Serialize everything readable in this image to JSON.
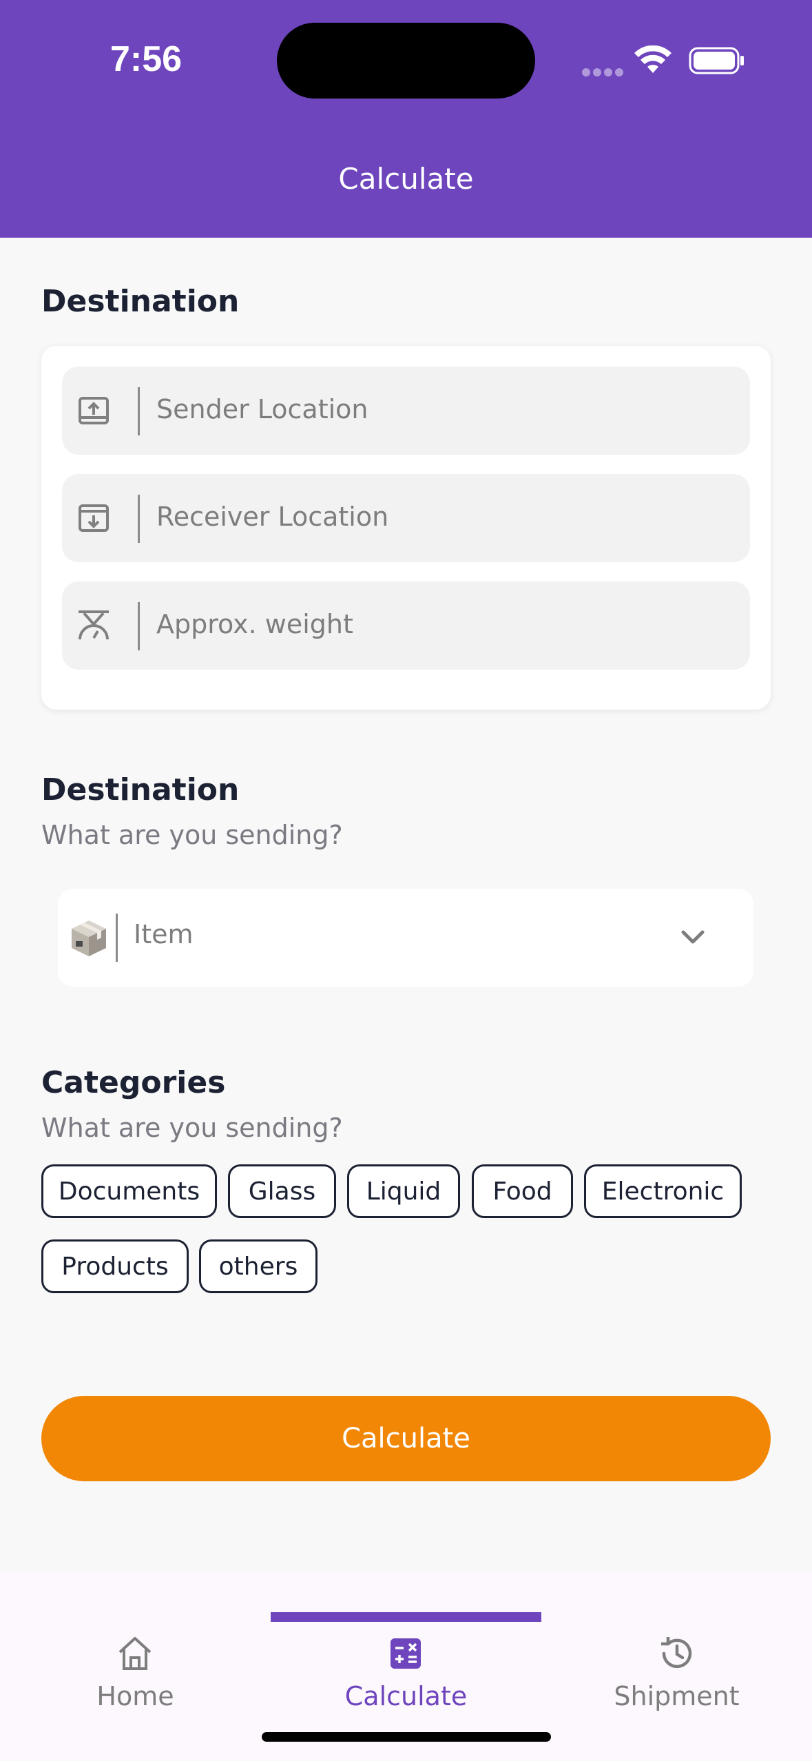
{
  "status_bar": {
    "time": "7:56"
  },
  "header": {
    "title": "Calculate"
  },
  "destination_section": {
    "title": "Destination",
    "fields": [
      {
        "icon": "upload-box-icon",
        "placeholder": "Sender Location"
      },
      {
        "icon": "download-box-icon",
        "placeholder": "Receiver Location"
      },
      {
        "icon": "scale-icon",
        "placeholder": "Approx. weight"
      }
    ]
  },
  "item_section": {
    "title": "Destination",
    "subtitle": "What are you sending?",
    "dropdown": {
      "icon": "package-icon",
      "selected": "Item"
    }
  },
  "categories_section": {
    "title": "Categories",
    "subtitle": "What are you sending?",
    "chips": [
      "Documents",
      "Glass",
      "Liquid",
      "Food",
      "Electronic",
      "Products",
      "others"
    ]
  },
  "calculate_button": {
    "label": "Calculate"
  },
  "bottom_nav": {
    "active": "Calculate",
    "items": [
      {
        "label": "Home",
        "icon": "home-icon"
      },
      {
        "label": "Calculate",
        "icon": "calculator-icon"
      },
      {
        "label": "Shipment",
        "icon": "history-icon"
      }
    ]
  },
  "colors": {
    "primary": "#6e45bd",
    "accent": "#f28705",
    "background": "#f8f8f8"
  }
}
